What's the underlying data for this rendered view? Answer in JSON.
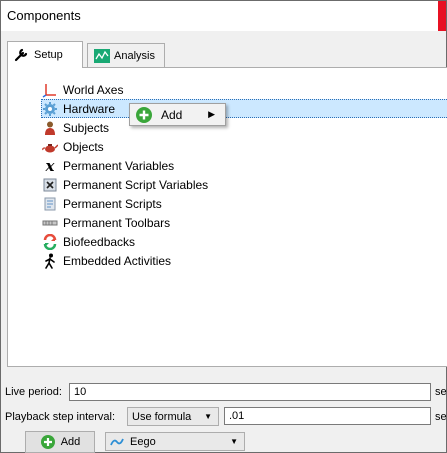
{
  "window": {
    "title": "Components"
  },
  "tabs": [
    {
      "label": "Setup",
      "icon": "wrench-icon"
    },
    {
      "label": "Analysis",
      "icon": "chart-icon"
    }
  ],
  "tree": {
    "items": [
      {
        "label": "World Axes",
        "icon": "axes-icon"
      },
      {
        "label": "Hardware",
        "icon": "gear-icon",
        "selected": true
      },
      {
        "label": "Subjects",
        "icon": "person-icon"
      },
      {
        "label": "Objects",
        "icon": "teapot-icon"
      },
      {
        "label": "Permanent Variables",
        "icon": "x-variable-icon"
      },
      {
        "label": "Permanent Script Variables",
        "icon": "script-variable-icon"
      },
      {
        "label": "Permanent Scripts",
        "icon": "script-icon"
      },
      {
        "label": "Permanent Toolbars",
        "icon": "toolbar-icon"
      },
      {
        "label": "Biofeedbacks",
        "icon": "biofeedback-icon"
      },
      {
        "label": "Embedded Activities",
        "icon": "walking-person-icon"
      }
    ]
  },
  "context_menu": {
    "add_label": "Add"
  },
  "bottom": {
    "live_period_label": "Live period:",
    "live_period_value": "10",
    "live_period_unit": "se",
    "playback_label": "Playback step interval:",
    "playback_mode": "Use formula",
    "playback_value": ".01",
    "playback_unit": "se",
    "add_button": "Add",
    "device_select": "Eego"
  },
  "colors": {
    "selection": "#cce8ff",
    "close": "#e81123",
    "add_green": "#3aa63a"
  }
}
